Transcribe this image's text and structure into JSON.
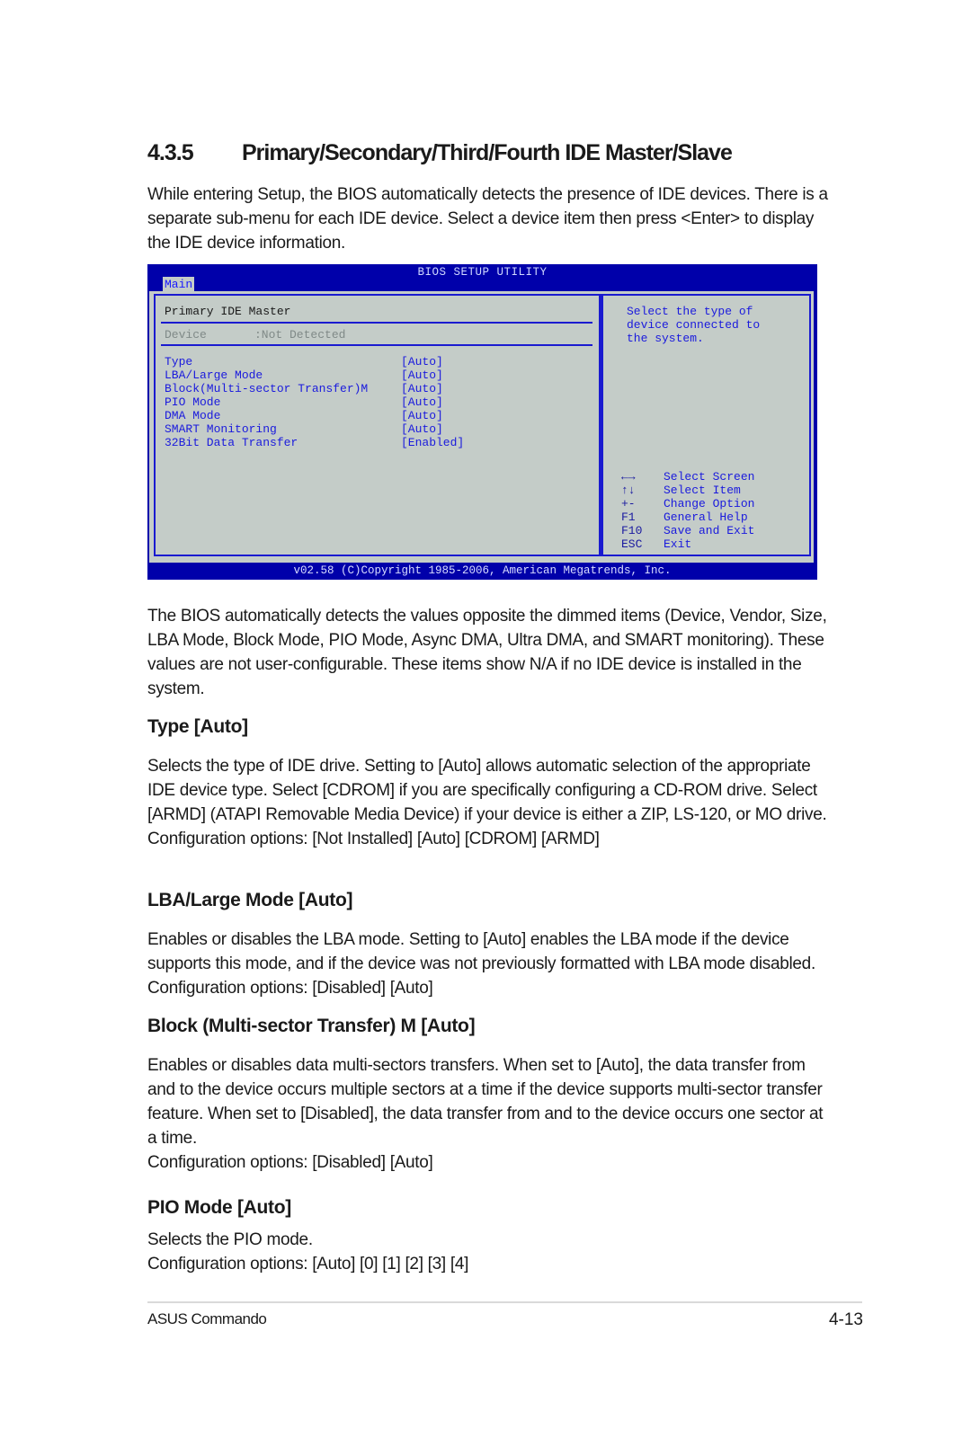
{
  "section": {
    "number": "4.3.5",
    "title": "Primary/Secondary/Third/Fourth IDE Master/Slave",
    "intro": "While entering Setup, the BIOS automatically detects the presence of IDE devices. There is a separate sub-menu for each IDE device. Select a device item then press <Enter> to display the IDE device information."
  },
  "bios": {
    "title": "BIOS SETUP UTILITY",
    "tab": "Main",
    "heading": "Primary IDE Master",
    "device_label": "Device",
    "device_value": ":Not Detected",
    "items": [
      {
        "label": "Type",
        "value": "[Auto]"
      },
      {
        "label": "LBA/Large Mode",
        "value": "[Auto]"
      },
      {
        "label": "Block(Multi-sector Transfer)M",
        "value": "[Auto]"
      },
      {
        "label": "PIO Mode",
        "value": "[Auto]"
      },
      {
        "label": "DMA Mode",
        "value": "[Auto]"
      },
      {
        "label": "SMART Monitoring",
        "value": "[Auto]"
      },
      {
        "label": "32Bit Data Transfer",
        "value": "[Enabled]"
      }
    ],
    "help_lines": [
      "Select the type of",
      "device connected to",
      "the system."
    ],
    "keys": [
      {
        "key": "←→",
        "icon": "left-right-arrows-icon",
        "action": "Select Screen"
      },
      {
        "key": "↑↓",
        "icon": "up-down-arrows-icon",
        "action": "Select Item"
      },
      {
        "key": "+-",
        "action": "Change Option"
      },
      {
        "key": "F1",
        "action": "General Help"
      },
      {
        "key": "F10",
        "action": "Save and Exit"
      },
      {
        "key": "ESC",
        "action": "Exit"
      }
    ],
    "footer": "v02.58 (C)Copyright 1985-2006, American Megatrends, Inc."
  },
  "body": {
    "auto_detect": "The BIOS automatically detects the values opposite the dimmed items (Device, Vendor, Size, LBA Mode, Block Mode, PIO Mode, Async DMA, Ultra DMA, and SMART monitoring). These values are not user-configurable. These items show N/A if no IDE device is installed in the system.",
    "subsections": [
      {
        "title": "Type [Auto]",
        "text": "Selects the type of IDE drive. Setting to [Auto] allows automatic selection of the appropriate IDE device type. Select [CDROM] if you are specifically configuring a CD-ROM drive. Select [ARMD] (ATAPI Removable Media Device) if your device is either a ZIP, LS-120, or MO drive.",
        "options": "Configuration options: [Not Installed] [Auto] [CDROM] [ARMD]"
      },
      {
        "title": "LBA/Large Mode [Auto]",
        "text": "Enables or disables the LBA mode. Setting to [Auto] enables the LBA mode if the device supports this mode, and if the device was not previously formatted with LBA mode disabled. Configuration options: [Disabled] [Auto]"
      },
      {
        "title": "Block (Multi-sector Transfer) M [Auto]",
        "text": "Enables or disables data multi-sectors transfers. When set to [Auto], the data transfer from and to the device occurs multiple sectors at a time if the device supports multi-sector transfer feature. When set to [Disabled], the data transfer from and to the device occurs one sector at a time.",
        "options": "Configuration options: [Disabled] [Auto]"
      },
      {
        "title": "PIO Mode [Auto]",
        "text": "Selects the PIO mode.",
        "options": "Configuration options: [Auto] [0] [1] [2] [3] [4]"
      }
    ]
  },
  "footer": {
    "product": "ASUS Commando",
    "page": "4-13"
  }
}
